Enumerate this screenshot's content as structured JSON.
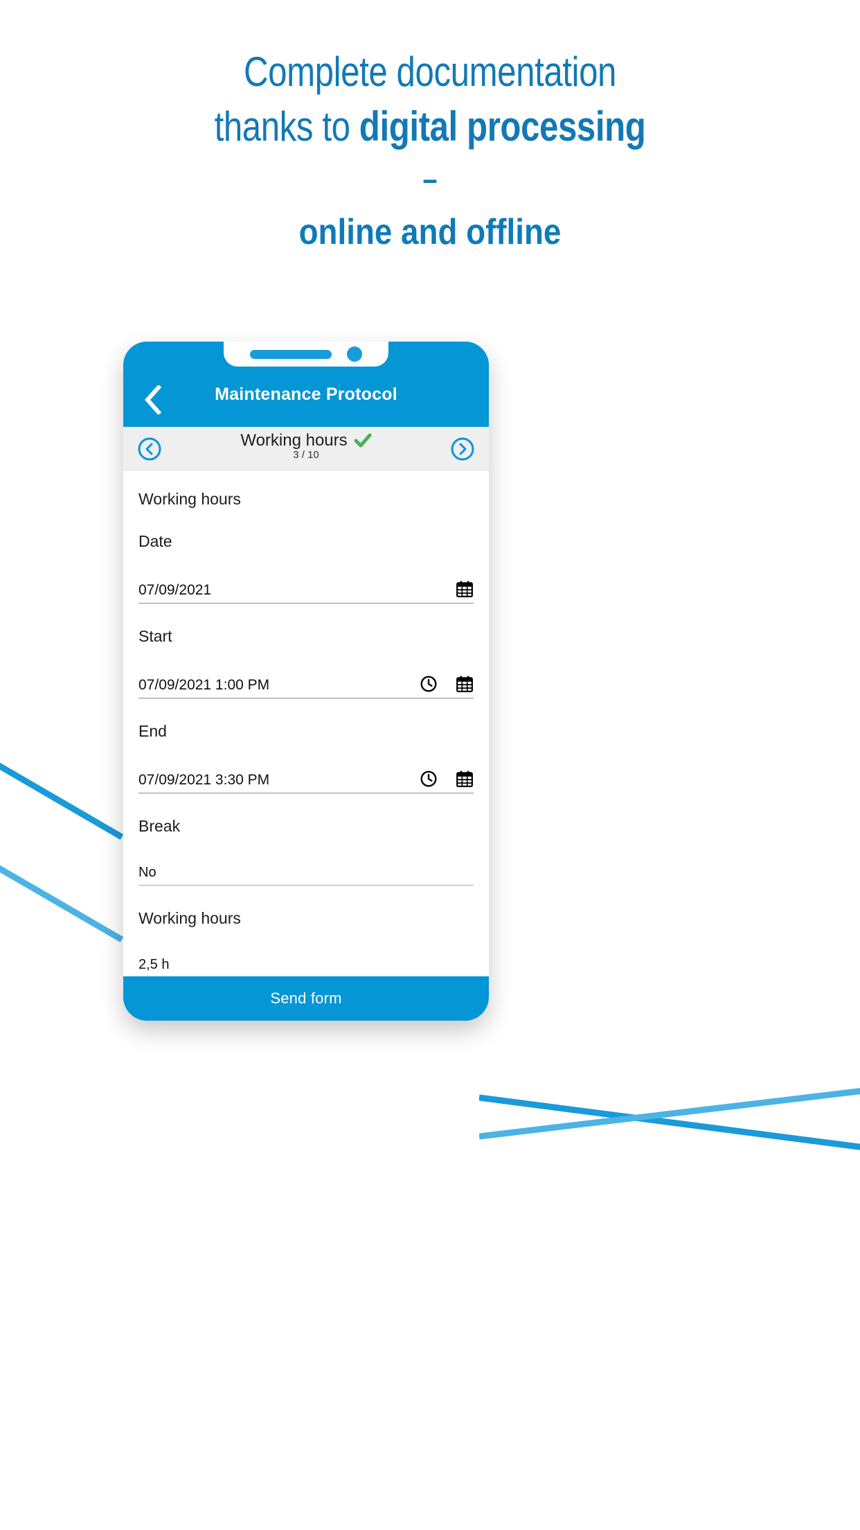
{
  "headline": {
    "line1": "Complete documentation",
    "line2_regular": "thanks to ",
    "line2_bold": "digital processing",
    "dash": "–",
    "line3": "online and offline",
    "color": "#1279b5"
  },
  "phone": {
    "appbar": {
      "back_icon": "chevron-left-icon",
      "title": "Maintenance Protocol",
      "background": "#0596d6"
    },
    "stepbar": {
      "prev_icon": "circle-chevron-left-icon",
      "next_icon": "circle-chevron-right-icon",
      "title": "Working hours",
      "check_icon": "green-check-icon",
      "check_color": "#4caf50",
      "count": "3 / 10",
      "background": "#efeff0"
    },
    "form": {
      "section_title": "Working hours",
      "fields": [
        {
          "label": "Date",
          "value": "07/09/2021",
          "icons": [
            "calendar-icon"
          ]
        },
        {
          "label": "Start",
          "value": "07/09/2021 1:00 PM",
          "icons": [
            "clock-icon",
            "calendar-icon"
          ]
        },
        {
          "label": "End",
          "value": "07/09/2021 3:30 PM",
          "icons": [
            "clock-icon",
            "calendar-icon"
          ]
        },
        {
          "label": "Break",
          "value": "No",
          "icons": []
        },
        {
          "label": "Working hours",
          "value": "2,5 h",
          "icons": []
        }
      ]
    },
    "send_button": {
      "label": "Send form",
      "background": "#0596d6"
    }
  },
  "decor": {
    "swoosh_color_dark": "#1a9ad8",
    "swoosh_color_light": "#4cb3e4"
  }
}
